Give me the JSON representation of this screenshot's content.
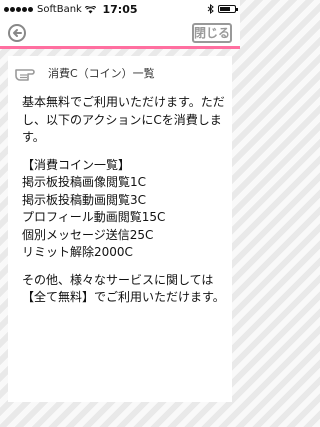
{
  "status_bar": {
    "carrier": "SoftBank",
    "time": "17:05",
    "battery_level": 0.7
  },
  "nav": {
    "back_icon": "back-circle-arrow",
    "close_label": "閉じる"
  },
  "page": {
    "heading": "消費C（コイン）一覧",
    "intro": "基本無料でご利用いただけます。ただし、以下のアクションにCを消費します。",
    "list_title": "【消費コイン一覧】",
    "items": [
      "掲示板投稿画像閲覧1C",
      "掲示板投稿動画閲覧3C",
      "プロフィール動画閲覧15C",
      "個別メッセージ送信25C",
      "リミット解除2000C"
    ],
    "footer": "その他、様々なサービスに関しては【全て無料】でご利用いただけます。"
  }
}
